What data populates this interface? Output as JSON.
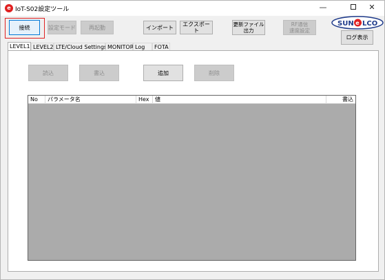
{
  "window": {
    "title": "IoT-S02設定ツール",
    "app_icon_letter": "e"
  },
  "toolbar": {
    "connect_label": "接続",
    "setmode_label": "設定モード",
    "restart_label": "再起動",
    "import_label": "インポート",
    "export_label": "エクスポート",
    "update_line1": "更新ファイル",
    "update_line2": "出力",
    "rf_line1": "RF通信",
    "rf_line2": "速度設定",
    "log_label": "ログ表示"
  },
  "logo": {
    "text_left": "SUN",
    "text_e": "e",
    "text_right": "LCO"
  },
  "tabs": [
    {
      "label": "LEVEL1",
      "active": true
    },
    {
      "label": "LEVEL2",
      "active": false
    },
    {
      "label": "LTE/Cloud Settings",
      "active": false
    },
    {
      "label": "MONITOR",
      "active": false
    },
    {
      "label": "Log",
      "active": false
    },
    {
      "label": "FOTA",
      "active": false
    }
  ],
  "panel": {
    "read_label": "読込",
    "write_label": "書込",
    "add_label": "追加",
    "delete_label": "削除"
  },
  "grid": {
    "columns": [
      "No",
      "パラメータ名",
      "Hex",
      "値",
      "書込"
    ]
  },
  "colors": {
    "accent": "#0078d7",
    "highlight_frame": "#e02020",
    "grid_bg": "#ababab"
  }
}
